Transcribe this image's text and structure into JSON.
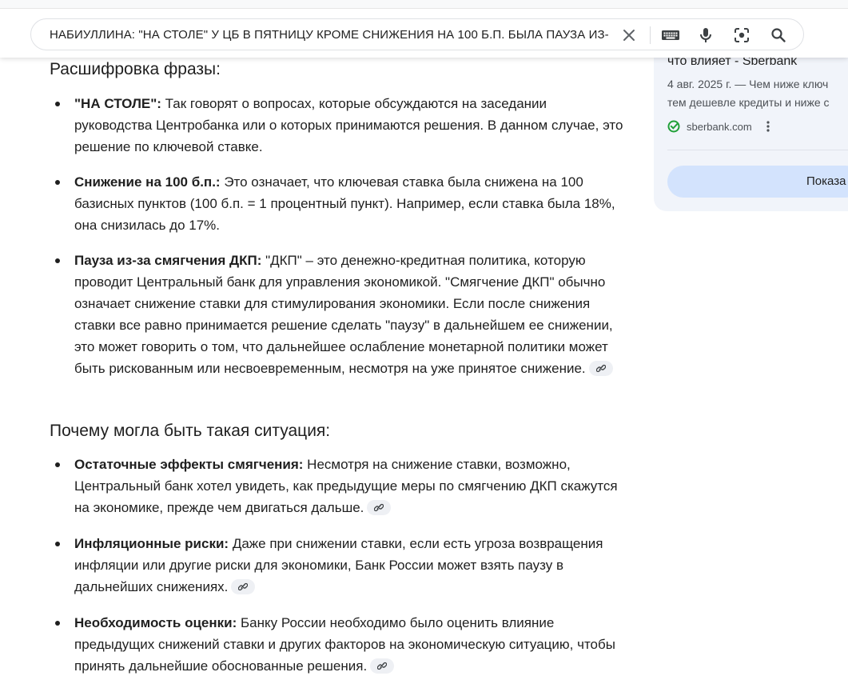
{
  "search": {
    "query": "НАБИУЛЛИНА: \"НА СТОЛЕ\" У ЦБ В ПЯТНИЦУ КРОМЕ СНИЖЕНИЯ НА 100 Б.П. БЫЛА ПАУЗА ИЗ-",
    "icons": [
      "close-icon",
      "keyboard-icon",
      "microphone-icon",
      "lens-icon",
      "search-icon"
    ]
  },
  "side": {
    "title": "что влияет - Sberbank",
    "snippet_line1": "4 авг. 2025 г. — Чем ниже ключ",
    "snippet_line2": "тем дешевле кредиты и ниже с",
    "source": "sberbank.com",
    "button_label": "Показа",
    "colors": {
      "card_bg": "#f1f4fa",
      "button_bg": "#d3e3fd",
      "favicon": "#21a038"
    }
  },
  "sections": [
    {
      "heading": "Расшифровка фразы:",
      "items": [
        {
          "term": "\"НА СТОЛЕ\":",
          "text": " Так говорят о вопросах, которые обсуждаются на заседании руководства Центробанка или о которых принимаются решения. В данном случае, это решение по ключевой ставке."
        },
        {
          "term": "Снижение на 100 б.п.:",
          "text": " Это означает, что ключевая ставка была снижена на 100 базисных пунктов (100 б.п. = 1 процентный пункт). Например, если ставка была 18%, она снизилась до 17%."
        },
        {
          "term": "Пауза из-за смягчения ДКП:",
          "text": " \"ДКП\" – это денежно-кредитная политика, которую проводит Центральный банк для управления экономикой. \"Смягчение ДКП\" обычно означает снижение ставки для стимулирования экономики. Если после снижения ставки все равно принимается решение сделать \"паузу\" в дальнейшем ее снижении, это может говорить о том, что дальнейшее ослабление монетарной политики может быть рискованным или несвоевременным, несмотря на уже принятое снижение."
        }
      ]
    },
    {
      "heading": "Почему могла быть такая ситуация:",
      "items": [
        {
          "term": "Остаточные эффекты смягчения:",
          "text": " Несмотря на снижение ставки, возможно, Центральный банк хотел увидеть, как предыдущие меры по смягчению ДКП скажутся на экономике, прежде чем двигаться дальше."
        },
        {
          "term": "Инфляционные риски:",
          "text": " Даже при снижении ставки, если есть угроза возвращения инфляции или другие риски для экономики, Банк России может взять паузу в дальнейших снижениях."
        },
        {
          "term": "Необходимость оценки:",
          "text": " Банку России необходимо было оценить влияние предыдущих снижений ставки и других факторов на экономическую ситуацию, чтобы принять дальнейшие обоснованные решения."
        }
      ]
    }
  ]
}
